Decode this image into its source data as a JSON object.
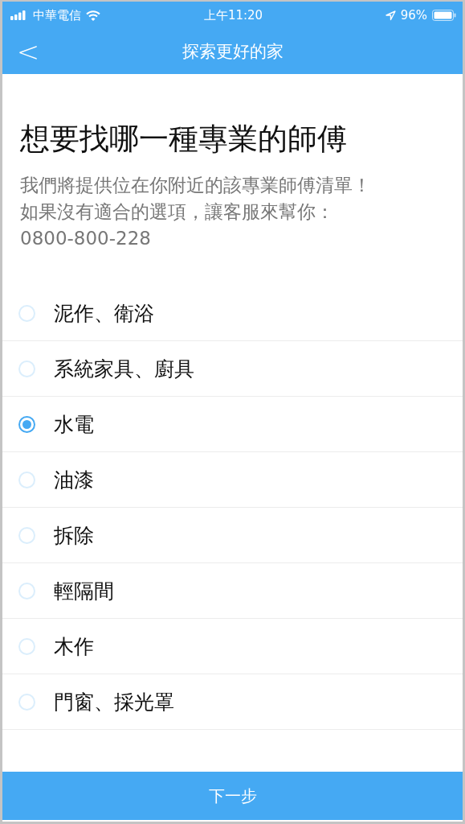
{
  "status_bar": {
    "carrier": "中華電信",
    "time": "上午11:20",
    "battery": "96%"
  },
  "nav": {
    "back": "<",
    "title": "探索更好的家"
  },
  "heading": "想要找哪一種專業的師傅",
  "description": [
    "我們將提供位在你附近的該專業師傅清單！",
    "如果沒有適合的選項，讓客服來幫你：",
    "0800-800-228"
  ],
  "options": [
    {
      "label": "泥作、衛浴",
      "selected": false
    },
    {
      "label": "系統家具、廚具",
      "selected": false
    },
    {
      "label": "水電",
      "selected": true
    },
    {
      "label": "油漆",
      "selected": false
    },
    {
      "label": "拆除",
      "selected": false
    },
    {
      "label": "輕隔間",
      "selected": false
    },
    {
      "label": "木作",
      "selected": false
    },
    {
      "label": "門窗、採光罩",
      "selected": false
    }
  ],
  "next_button": "下一步"
}
